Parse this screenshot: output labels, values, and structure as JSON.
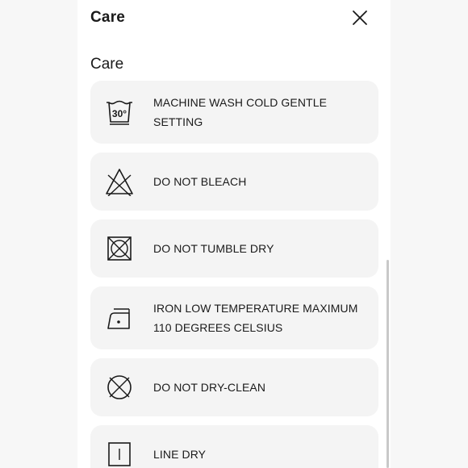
{
  "modal": {
    "title": "Care",
    "close_icon": "close-icon"
  },
  "section": {
    "title": "Care"
  },
  "care_items": [
    {
      "icon": "machine-wash-30-icon",
      "label": "MACHINE WASH COLD GENTLE SETTING"
    },
    {
      "icon": "do-not-bleach-icon",
      "label": "DO NOT BLEACH"
    },
    {
      "icon": "do-not-tumble-dry-icon",
      "label": "DO NOT TUMBLE DRY"
    },
    {
      "icon": "iron-low-icon",
      "label": "IRON LOW TEMPERATURE MAXIMUM 110 DEGREES CELSIUS"
    },
    {
      "icon": "do-not-dry-clean-icon",
      "label": "DO NOT DRY-CLEAN"
    },
    {
      "icon": "line-dry-icon",
      "label": "LINE DRY"
    }
  ],
  "wash_temp": "30°"
}
